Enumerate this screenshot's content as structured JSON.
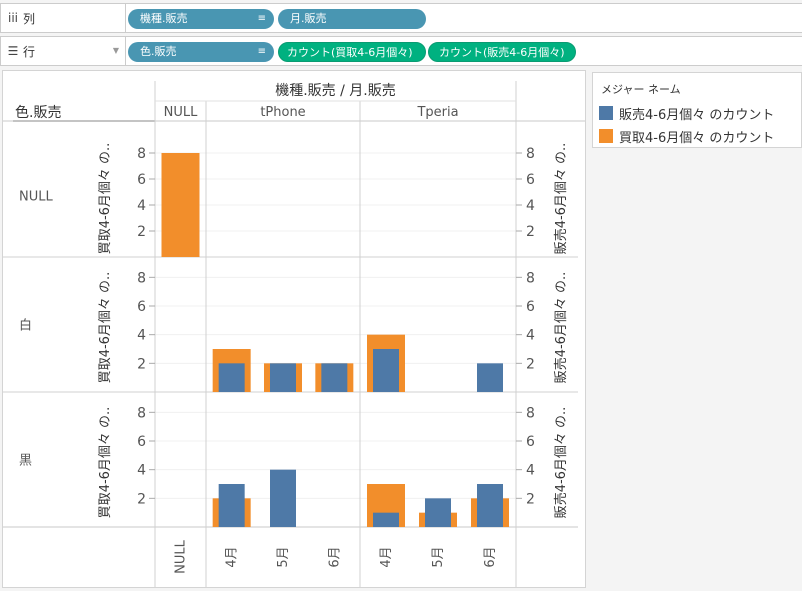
{
  "shelves": {
    "columns": {
      "label": "列",
      "icon": "column-icon",
      "pills": [
        {
          "text": "機種.販売",
          "sort": "sort-icon"
        },
        {
          "text": "月.販売"
        }
      ]
    },
    "rows": {
      "label": "行",
      "icon": "row-icon",
      "pills": [
        {
          "text": "色.販売",
          "sort": "sort-icon"
        },
        {
          "text": "カウント(買取4-6月個々)"
        },
        {
          "text": "カウント(販売4-6月個々)"
        }
      ]
    }
  },
  "legend": {
    "title": "メジャー ネーム",
    "items": [
      {
        "label": "販売4-6月個々 のカウント",
        "color": "#4e79a7"
      },
      {
        "label": "買取4-6月個々 のカウント",
        "color": "#f28e2b"
      }
    ]
  },
  "chart_data": {
    "type": "bar",
    "title": "機種.販売 / 月.販売",
    "row_header": "色.販売",
    "left_axis_label": "買取4-6月個々 の..",
    "right_axis_label": "販売4-6月個々 の..",
    "y_ticks": [
      2,
      4,
      6,
      8
    ],
    "ylim": [
      0,
      9
    ],
    "panes_x": [
      {
        "model": "NULL",
        "months": [
          "NULL"
        ]
      },
      {
        "model": "tPhone",
        "months": [
          "4月",
          "5月",
          "6月"
        ]
      },
      {
        "model": "Tperia",
        "months": [
          "4月",
          "5月",
          "6月"
        ]
      }
    ],
    "rows": [
      {
        "color": "NULL",
        "buy": [
          8,
          null,
          null,
          null,
          null,
          null,
          null
        ],
        "sell": [
          null,
          null,
          null,
          null,
          null,
          null,
          null
        ]
      },
      {
        "color": "白",
        "buy": [
          null,
          3,
          2,
          2,
          4,
          null,
          null
        ],
        "sell": [
          null,
          2,
          2,
          2,
          3,
          null,
          2
        ]
      },
      {
        "color": "黒",
        "buy": [
          null,
          2,
          null,
          null,
          3,
          1,
          2
        ],
        "sell": [
          null,
          3,
          4,
          null,
          1,
          2,
          3
        ]
      }
    ],
    "series": [
      {
        "name": "販売4-6月個々 のカウント",
        "key": "sell",
        "color": "#4e79a7"
      },
      {
        "name": "買取4-6月個々 のカウント",
        "key": "buy",
        "color": "#f28e2b"
      }
    ]
  }
}
